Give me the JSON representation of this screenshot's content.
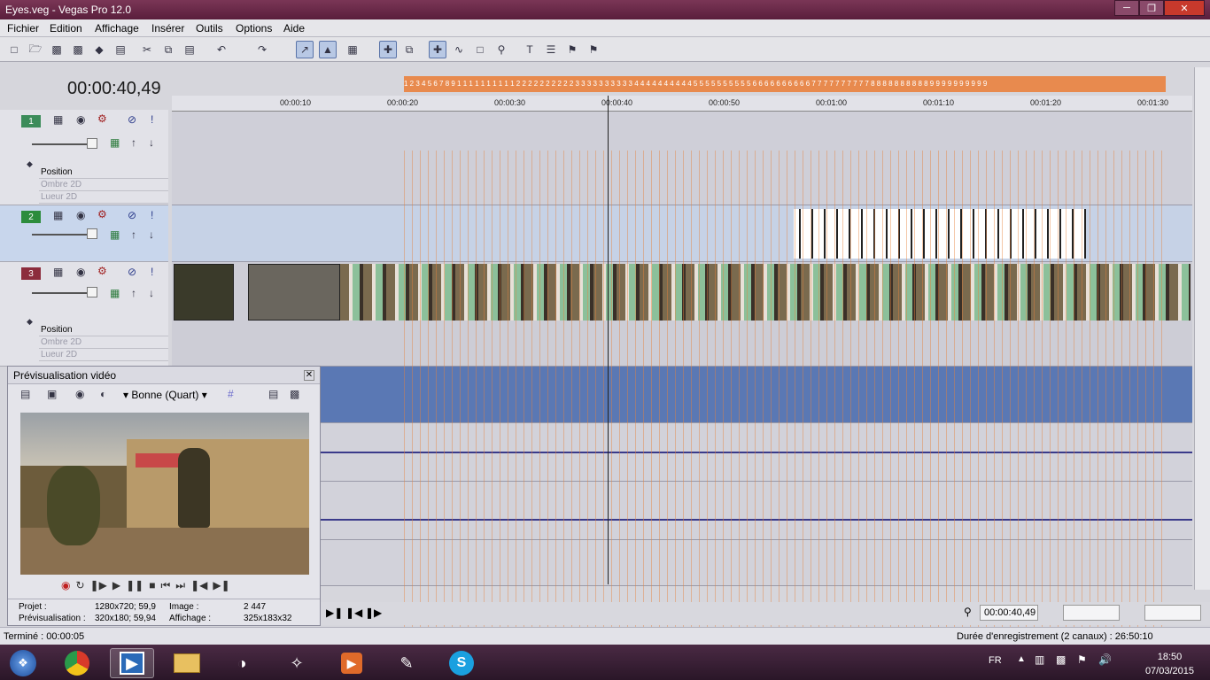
{
  "window": {
    "title": "Eyes.veg - Vegas Pro 12.0"
  },
  "menu": [
    "Fichier",
    "Edition",
    "Affichage",
    "Insérer",
    "Outils",
    "Options",
    "Aide"
  ],
  "timecode": "00:00:40,49",
  "ruler_labels": [
    "00:00:10",
    "00:00:20",
    "00:00:30",
    "00:00:40",
    "00:00:50",
    "00:01:00",
    "00:01:10",
    "00:01:20",
    "00:01:30"
  ],
  "marker_text": "1 2 3 4 5 6 7 8 9 1 1 1 1 1 1 1 1 1 1 2 2 2 2 2 2 2 2 2 2 3 3 3 3 3 3 3 3 3 3 4 4 4 4 4 4 4 4 4 4 5 5 5 5 5 5 5 5 5 5 6 6 6 6 6 6 6 6 6 6 7 7 7 7 7 7 7 7 7 7 8 8 8 8 8 8 8 8 8 8 9 9 9 9 9 9 9 9 9 9",
  "tracks": [
    {
      "number": "1",
      "envelopes": [
        "Position",
        "Ombre 2D",
        "Lueur 2D"
      ]
    },
    {
      "number": "2",
      "envelopes": []
    },
    {
      "number": "3",
      "envelopes": [
        "Position",
        "Ombre 2D",
        "Lueur 2D"
      ]
    }
  ],
  "preview": {
    "title": "Prévisualisation vidéo",
    "quality": "Bonne (Quart)",
    "projet_label": "Projet :",
    "projet_value": "1280x720; 59,9",
    "image_label": "Image :",
    "image_value": "2 447",
    "previs_label": "Prévisualisation :",
    "previs_value": "320x180; 59,94",
    "affichage_label": "Affichage :",
    "affichage_value": "325x183x32"
  },
  "bottom": {
    "timecode": "00:00:40,49"
  },
  "status": {
    "left": "Terminé : 00:00:05",
    "right": "Durée d'enregistrement (2 canaux) : 26:50:10"
  },
  "taskbar": {
    "lang": "FR",
    "time": "18:50",
    "date": "07/03/2015"
  }
}
